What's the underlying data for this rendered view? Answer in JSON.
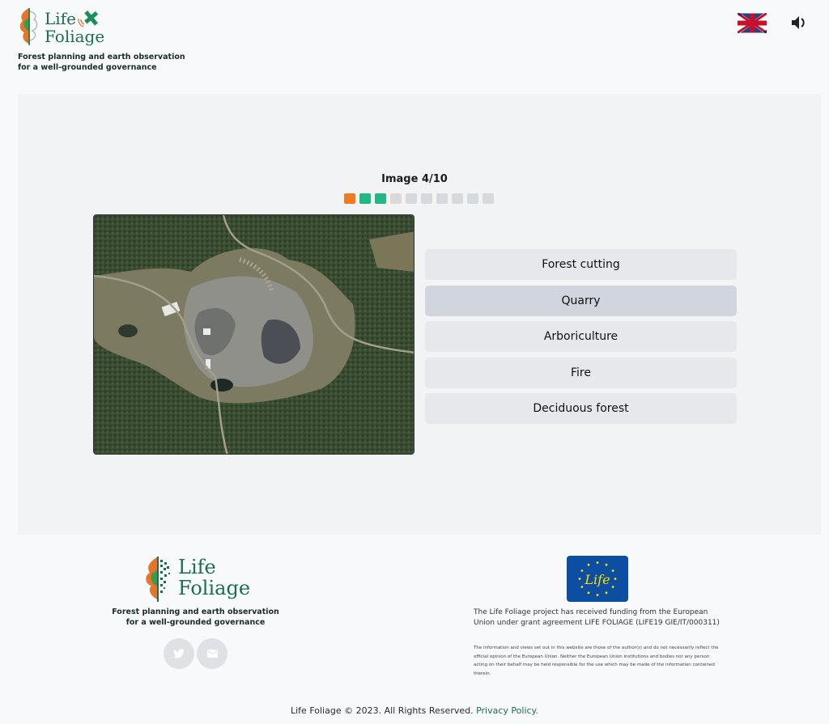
{
  "header": {
    "logo_line1": "Life",
    "logo_line2": "Foliage",
    "tagline_line1": "Forest planning and earth observation",
    "tagline_line2": "for a well-grounded governance",
    "language_icon": "uk-flag-icon",
    "sound_icon": "speaker-icon"
  },
  "quiz": {
    "counter": "Image 4/10",
    "current": 4,
    "total": 10,
    "progress": [
      "wrong",
      "right",
      "right",
      "current",
      "pending",
      "pending",
      "pending",
      "pending",
      "pending",
      "pending"
    ],
    "image_alt": "Satellite image of a quarry surrounded by forest",
    "answers": [
      {
        "label": "Forest cutting"
      },
      {
        "label": "Quarry"
      },
      {
        "label": "Arboriculture"
      },
      {
        "label": "Fire"
      },
      {
        "label": "Deciduous forest"
      }
    ]
  },
  "footer": {
    "logo_line1": "Life",
    "logo_line2": "Foliage",
    "tagline_line1": "Forest planning and earth observation",
    "tagline_line2": "for a well-grounded governance",
    "social": [
      {
        "name": "twitter",
        "icon": "twitter-icon"
      },
      {
        "name": "email",
        "icon": "mail-icon"
      }
    ],
    "eu_logo_text": "Life",
    "funding": "The Life Foliage project has received funding from the European Union under grant agreement LIFE FOLIAGE (LIFE19 GIE/IT/000311)",
    "disclaimer": "The information and views set out in this website are those of the author(s) and do not necessarily reflect the official opinion of the European Union. Neither the European Union institutions and bodies nor any person acting on their behalf may be held responsible for the use which may be made of the information contained therein.",
    "copyright": "Life Foliage © 2023. All Rights Reserved.",
    "privacy_link": "Privacy Policy."
  },
  "colors": {
    "brand_green": "#1b6e56",
    "wrong": "#f07a1f",
    "right": "#22b884",
    "pending": "#d6d9dd"
  }
}
